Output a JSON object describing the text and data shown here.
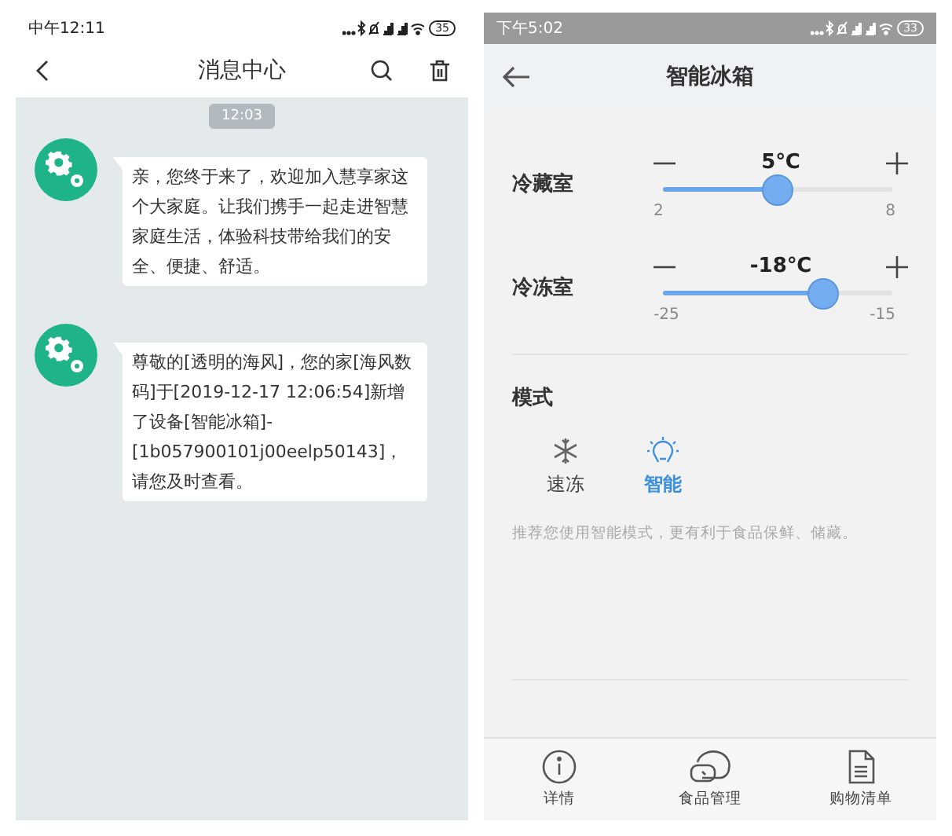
{
  "screens": [
    {
      "status_bar": {
        "time": "中午12:11",
        "battery": "35"
      },
      "header": {
        "title": "消息中心"
      },
      "time_chip": "12:03",
      "messages": [
        {
          "text": "亲，您终于来了，欢迎加入慧享家这个大家庭。让我们携手一起走进智慧家庭生活，体验科技带给我们的安全、便捷、舒适。"
        },
        {
          "text": "尊敬的[透明的海风]，您的家[海风数码]于[2019-12-17 12:06:54]新增了设备[智能冰箱]-[1b057900101j00eelp50143]，请您及时查看。"
        }
      ]
    },
    {
      "status_bar": {
        "time": "下午5:02",
        "battery": "33"
      },
      "header": {
        "title": "智能冰箱"
      },
      "compartments": [
        {
          "name": "冷藏室",
          "reading": "5℃",
          "level": 0.5,
          "min": "2",
          "max": "8"
        },
        {
          "name": "冷冻室",
          "reading": "-18℃",
          "level": 0.7,
          "min": "-25",
          "max": "-15"
        }
      ],
      "mode_title": "模式",
      "modes": [
        {
          "kind": "snowflake",
          "label": "速冻",
          "selected": false
        },
        {
          "kind": "bulb",
          "label": "智能",
          "selected": true
        }
      ],
      "mode_hint": "推荐您使用智能模式，更有利于食品保鲜、储藏。",
      "nav": [
        {
          "kind": "info",
          "label": "详情"
        },
        {
          "kind": "food",
          "label": "食品管理"
        },
        {
          "kind": "list",
          "label": "购物清单"
        }
      ]
    }
  ]
}
